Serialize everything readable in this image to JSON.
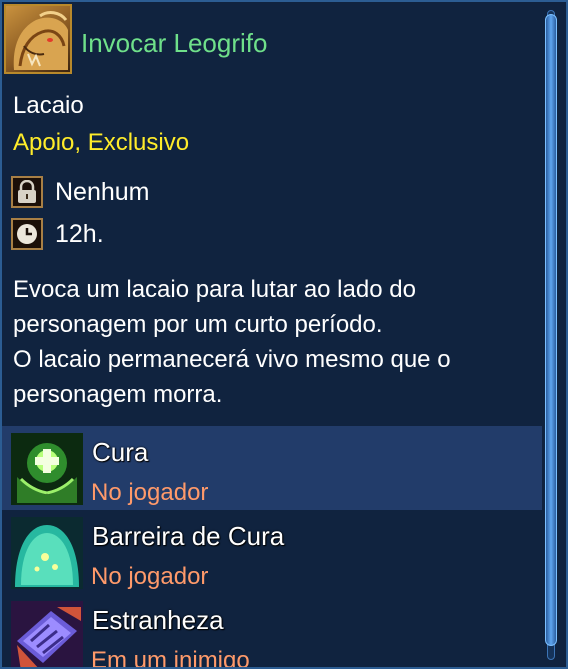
{
  "header": {
    "title": "Invocar Leogrifo",
    "icon": "griffin-portrait-icon"
  },
  "skill": {
    "type": "Lacaio",
    "tags": "Apoio, Exclusivo",
    "requirement": {
      "icon": "lock-icon",
      "value": "Nenhum"
    },
    "duration": {
      "icon": "clock-icon",
      "value": "12h."
    },
    "description": [
      "Evoca um lacaio para lutar ao lado do",
      "personagem por um curto período.",
      "O lacaio permanecerá vivo mesmo que o",
      "personagem morra."
    ]
  },
  "abilities": [
    {
      "name": "Cura",
      "target": "No jogador",
      "icon": "heal-hands-icon",
      "selected": true
    },
    {
      "name": "Barreira de Cura",
      "target": "No jogador",
      "icon": "heal-barrier-icon",
      "selected": false
    },
    {
      "name": "Estranheza",
      "target": "Em um inimigo",
      "icon": "weird-book-icon",
      "selected": false
    }
  ],
  "colors": {
    "background": "#10233f",
    "title": "#6fe08a",
    "tags": "#ffec2a",
    "target": "#ff9a6a",
    "selected_row": "#223c6a"
  }
}
